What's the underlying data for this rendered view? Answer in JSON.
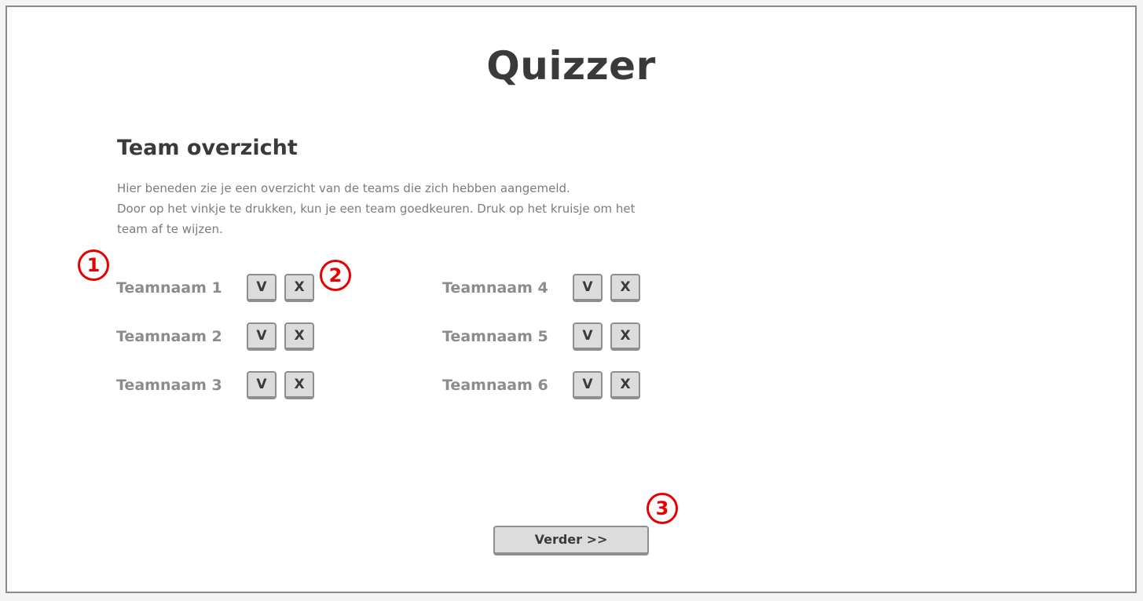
{
  "app_title": "Quizzer",
  "section": {
    "title": "Team overzicht",
    "description": [
      "Hier beneden zie je een overzicht van de teams die zich hebben aangemeld.",
      "Door op het vinkje te drukken, kun je een team goedkeuren. Druk op het kruisje om het team af te wijzen."
    ]
  },
  "teams": [
    {
      "name": "Teamnaam 1",
      "approve_label": "V",
      "reject_label": "X"
    },
    {
      "name": "Teamnaam 2",
      "approve_label": "V",
      "reject_label": "X"
    },
    {
      "name": "Teamnaam 3",
      "approve_label": "V",
      "reject_label": "X"
    },
    {
      "name": "Teamnaam 4",
      "approve_label": "V",
      "reject_label": "X"
    },
    {
      "name": "Teamnaam 5",
      "approve_label": "V",
      "reject_label": "X"
    },
    {
      "name": "Teamnaam 6",
      "approve_label": "V",
      "reject_label": "X"
    }
  ],
  "next_button": {
    "label": "Verder >>"
  },
  "annotations": [
    "1",
    "2",
    "3"
  ],
  "colors": {
    "annotation": "#e60000",
    "button_bg": "#dcdcdc",
    "button_border": "#8e8e8e",
    "title_text": "#3a3a3a",
    "muted_text": "#8c8c8c"
  }
}
